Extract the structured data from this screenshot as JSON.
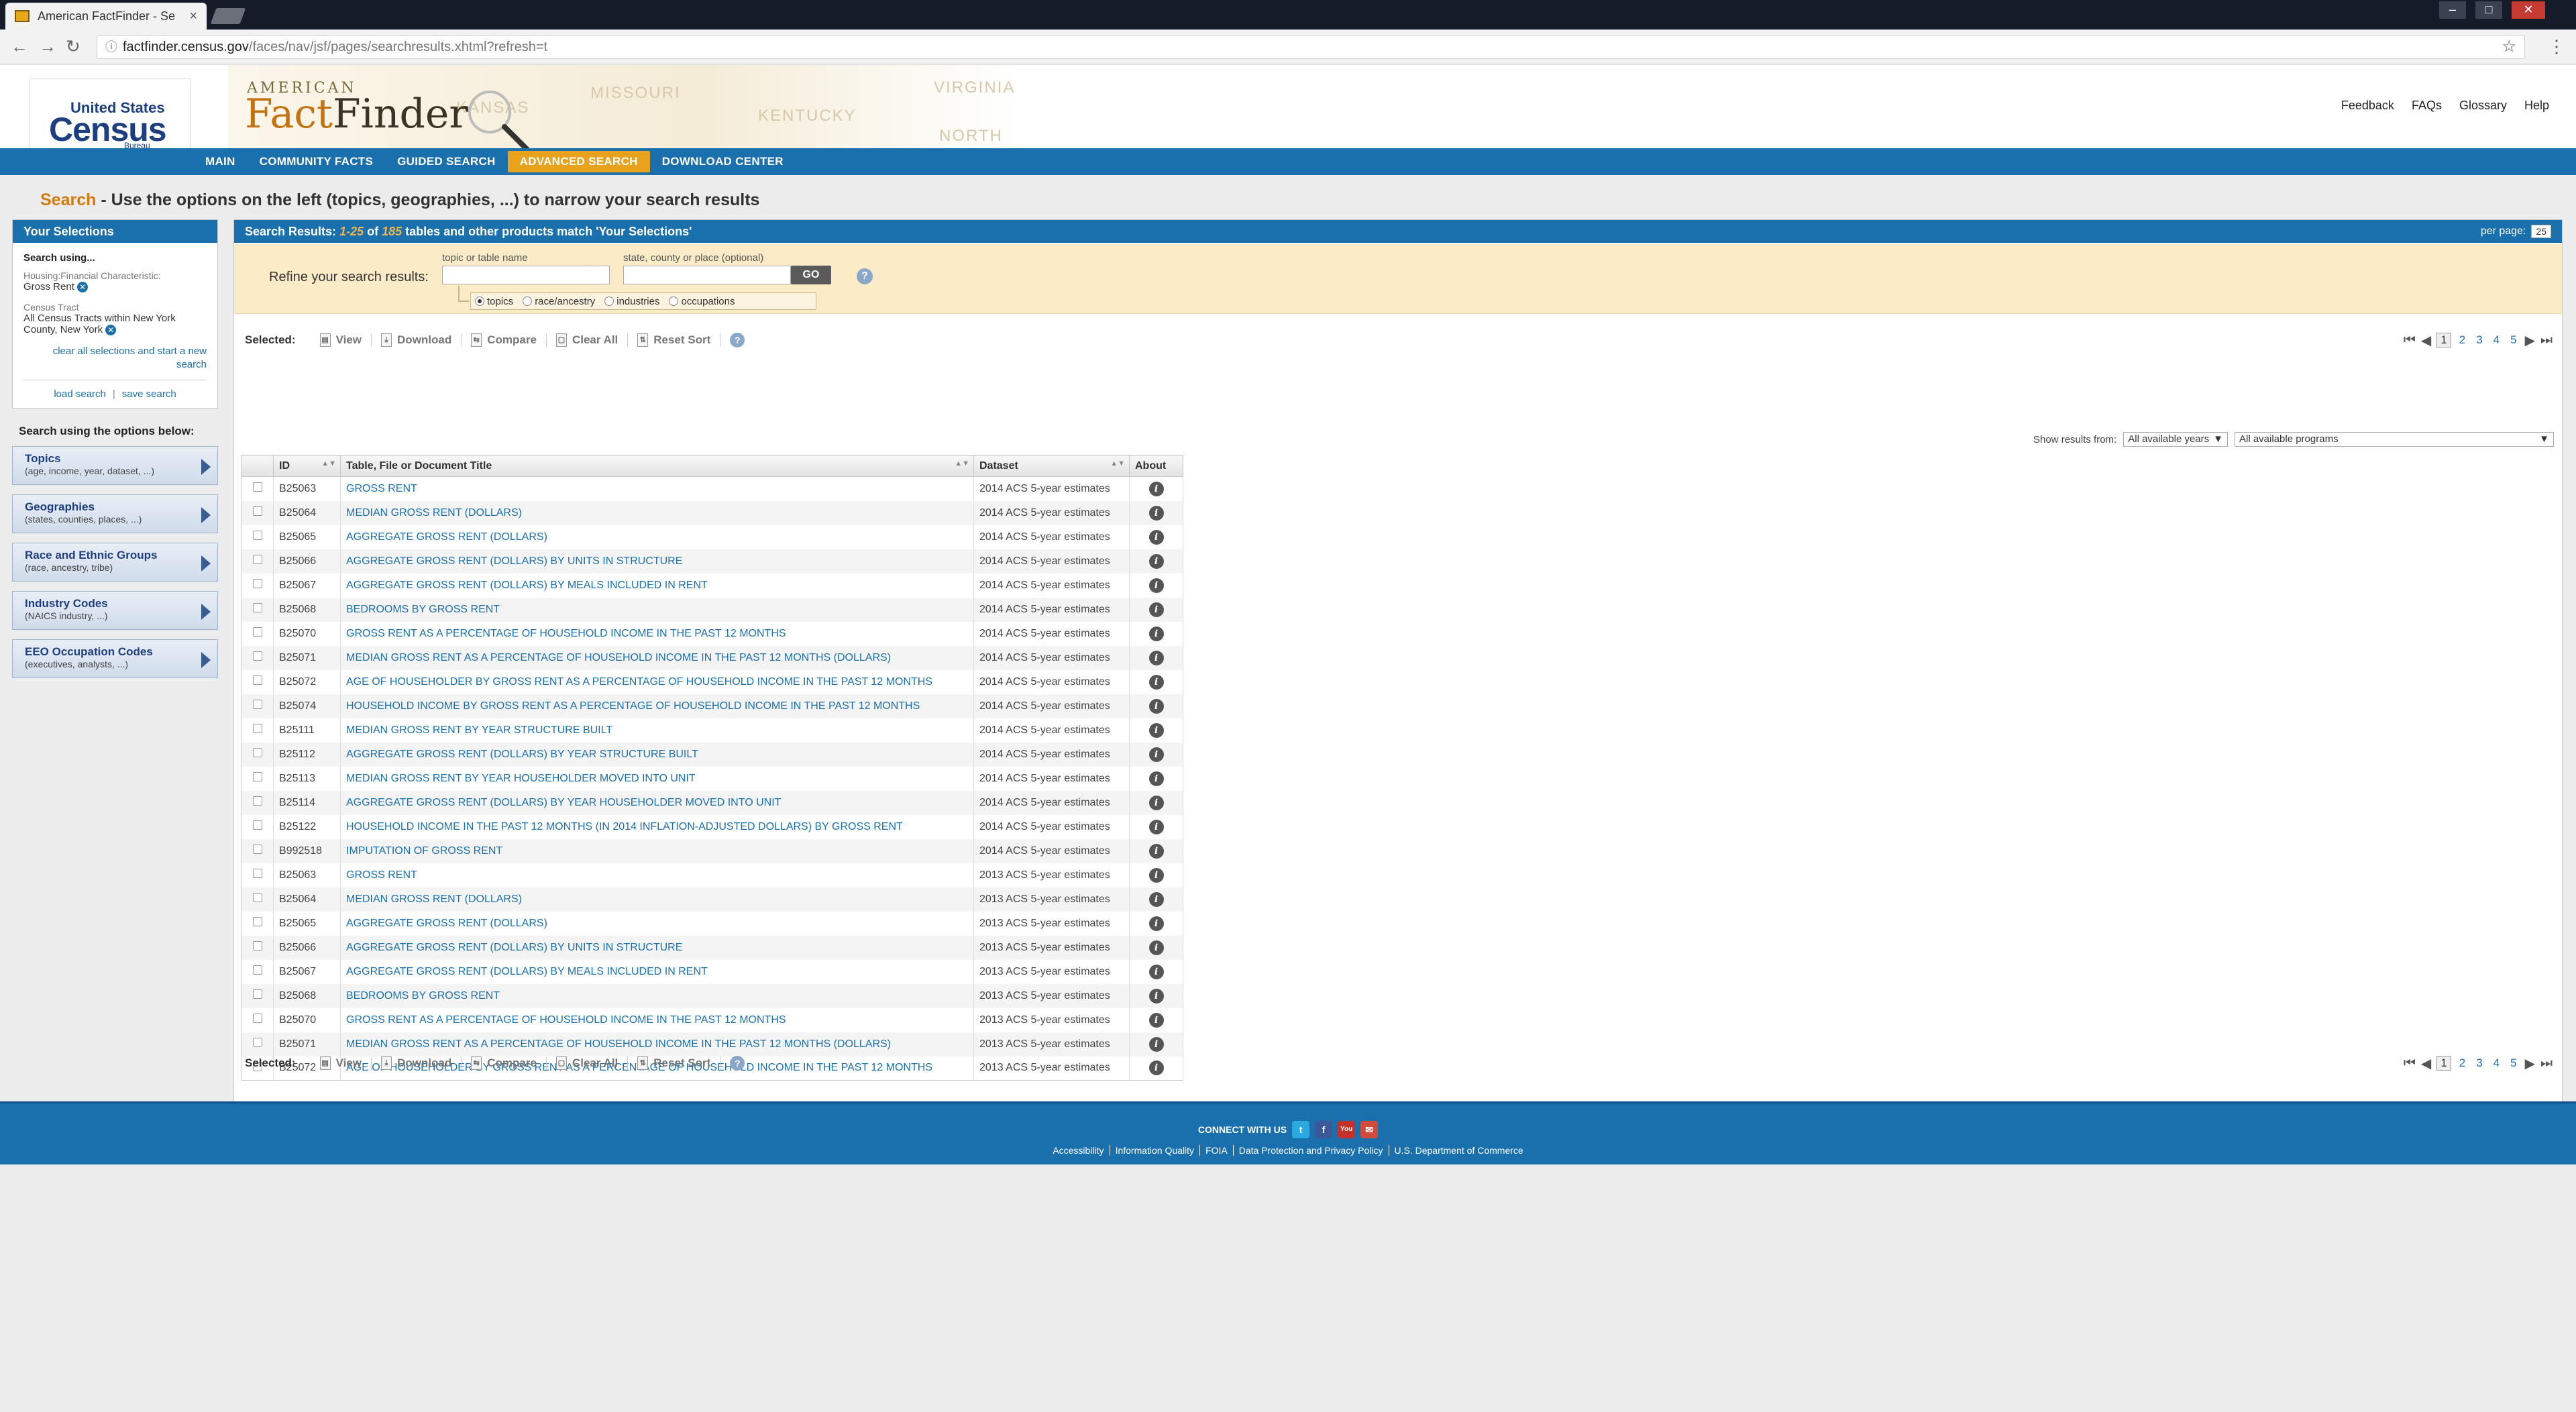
{
  "browser": {
    "tab_title": "American FactFinder - Se",
    "tab_close": "×",
    "url_host": "factfinder.census.gov",
    "url_path": "/faces/nav/jsf/pages/searchresults.xhtml?refresh=t",
    "back_glyph": "←",
    "forward_glyph": "→",
    "reload_glyph": "↻",
    "lock_glyph": "ⓘ",
    "star_glyph": "☆",
    "menu_glyph": "⋮",
    "win_minimize": "–",
    "win_maximize": "□",
    "win_close": "✕"
  },
  "header": {
    "logo_line1": "United States",
    "logo_line2": "Census",
    "logo_line3": "Bureau",
    "brand_small": "AMERICAN",
    "brand_part1": "Fact",
    "brand_part2": "Finder",
    "map_labels": [
      "MISSOURI",
      "KENTUCKY",
      "VIRGINIA",
      "NORTH",
      "KANSAS"
    ],
    "links": [
      "Feedback",
      "FAQs",
      "Glossary",
      "Help"
    ]
  },
  "nav": {
    "items": [
      "MAIN",
      "COMMUNITY FACTS",
      "GUIDED SEARCH",
      "ADVANCED SEARCH",
      "DOWNLOAD CENTER"
    ],
    "active_index": 3
  },
  "page_title": {
    "lead": "Search",
    "text": " - Use the options on the left (topics, geographies, ...) to narrow your search results"
  },
  "selections": {
    "heading": "Your Selections",
    "search_using": "Search using...",
    "items": [
      {
        "category": "Housing:Financial Characteristic:",
        "value": "Gross Rent"
      },
      {
        "category": "Census Tract",
        "value": "All Census Tracts within New York County, New York"
      }
    ],
    "remove_glyph": "✕",
    "clear_link": "clear all selections and start a new search",
    "load_search": "load search",
    "separator": "|",
    "save_search": "save search"
  },
  "search_options": {
    "heading": "Search using the options below:",
    "options": [
      {
        "title": "Topics",
        "subtitle": "(age, income, year, dataset, ...)"
      },
      {
        "title": "Geographies",
        "subtitle": "(states, counties, places, ...)"
      },
      {
        "title": "Race and Ethnic Groups",
        "subtitle": "(race, ancestry, tribe)"
      },
      {
        "title": "Industry Codes",
        "subtitle": "(NAICS industry, ...)"
      },
      {
        "title": "EEO Occupation Codes",
        "subtitle": "(executives, analysts, ...)"
      }
    ]
  },
  "results_header": {
    "prefix": "Search Results: ",
    "range": "1-25",
    "of": " of ",
    "total": "185",
    "suffix": " tables and other products match 'Your Selections'",
    "per_page_label": "per page:",
    "per_page_value": "25"
  },
  "refine": {
    "label": "Refine your search results:",
    "topic_label": "topic or table name",
    "geo_label": "state, county or place (optional)",
    "topic_value": "",
    "geo_value": "",
    "go": "GO",
    "help": "?",
    "radios": [
      {
        "label": "topics",
        "checked": true
      },
      {
        "label": "race/ancestry",
        "checked": false
      },
      {
        "label": "industries",
        "checked": false
      },
      {
        "label": "occupations",
        "checked": false
      }
    ]
  },
  "toolbar": {
    "selected": "Selected:",
    "view": "View",
    "download": "Download",
    "compare": "Compare",
    "clear_all": "Clear All",
    "reset_sort": "Reset Sort",
    "help": "?",
    "icon_view": "▤",
    "icon_download": "⤓",
    "icon_compare": "⇆",
    "icon_clear": "▢",
    "icon_reset": "⇅"
  },
  "pager": {
    "first": "⏮",
    "prev": "◀",
    "pages": [
      "1",
      "2",
      "3",
      "4",
      "5"
    ],
    "current": "1",
    "next": "▶",
    "last": "⏭"
  },
  "filters": {
    "label": "Show results from:",
    "years": "All available years",
    "programs": "All available programs",
    "caret": "▼"
  },
  "table": {
    "columns": [
      "ID",
      "Table, File or Document Title",
      "Dataset",
      "About"
    ],
    "sort_glyph": "▲▼",
    "info_glyph": "i",
    "rows": [
      [
        "B25063",
        "GROSS RENT",
        "2014 ACS 5-year estimates"
      ],
      [
        "B25064",
        "MEDIAN GROSS RENT (DOLLARS)",
        "2014 ACS 5-year estimates"
      ],
      [
        "B25065",
        "AGGREGATE GROSS RENT (DOLLARS)",
        "2014 ACS 5-year estimates"
      ],
      [
        "B25066",
        "AGGREGATE GROSS RENT (DOLLARS) BY UNITS IN STRUCTURE",
        "2014 ACS 5-year estimates"
      ],
      [
        "B25067",
        "AGGREGATE GROSS RENT (DOLLARS) BY MEALS INCLUDED IN RENT",
        "2014 ACS 5-year estimates"
      ],
      [
        "B25068",
        "BEDROOMS BY GROSS RENT",
        "2014 ACS 5-year estimates"
      ],
      [
        "B25070",
        "GROSS RENT AS A PERCENTAGE OF HOUSEHOLD INCOME IN THE PAST 12 MONTHS",
        "2014 ACS 5-year estimates"
      ],
      [
        "B25071",
        "MEDIAN GROSS RENT AS A PERCENTAGE OF HOUSEHOLD INCOME IN THE PAST 12 MONTHS (DOLLARS)",
        "2014 ACS 5-year estimates"
      ],
      [
        "B25072",
        "AGE OF HOUSEHOLDER BY GROSS RENT AS A PERCENTAGE OF HOUSEHOLD INCOME IN THE PAST 12 MONTHS",
        "2014 ACS 5-year estimates"
      ],
      [
        "B25074",
        "HOUSEHOLD INCOME BY GROSS RENT AS A PERCENTAGE OF HOUSEHOLD INCOME IN THE PAST 12 MONTHS",
        "2014 ACS 5-year estimates"
      ],
      [
        "B25111",
        "MEDIAN GROSS RENT BY YEAR STRUCTURE BUILT",
        "2014 ACS 5-year estimates"
      ],
      [
        "B25112",
        "AGGREGATE GROSS RENT (DOLLARS) BY YEAR STRUCTURE BUILT",
        "2014 ACS 5-year estimates"
      ],
      [
        "B25113",
        "MEDIAN GROSS RENT BY YEAR HOUSEHOLDER MOVED INTO UNIT",
        "2014 ACS 5-year estimates"
      ],
      [
        "B25114",
        "AGGREGATE GROSS RENT (DOLLARS) BY YEAR HOUSEHOLDER MOVED INTO UNIT",
        "2014 ACS 5-year estimates"
      ],
      [
        "B25122",
        "HOUSEHOLD INCOME IN THE PAST 12 MONTHS (IN 2014 INFLATION-ADJUSTED DOLLARS) BY GROSS RENT",
        "2014 ACS 5-year estimates"
      ],
      [
        "B992518",
        "IMPUTATION OF GROSS RENT",
        "2014 ACS 5-year estimates"
      ],
      [
        "B25063",
        "GROSS RENT",
        "2013 ACS 5-year estimates"
      ],
      [
        "B25064",
        "MEDIAN GROSS RENT (DOLLARS)",
        "2013 ACS 5-year estimates"
      ],
      [
        "B25065",
        "AGGREGATE GROSS RENT (DOLLARS)",
        "2013 ACS 5-year estimates"
      ],
      [
        "B25066",
        "AGGREGATE GROSS RENT (DOLLARS) BY UNITS IN STRUCTURE",
        "2013 ACS 5-year estimates"
      ],
      [
        "B25067",
        "AGGREGATE GROSS RENT (DOLLARS) BY MEALS INCLUDED IN RENT",
        "2013 ACS 5-year estimates"
      ],
      [
        "B25068",
        "BEDROOMS BY GROSS RENT",
        "2013 ACS 5-year estimates"
      ],
      [
        "B25070",
        "GROSS RENT AS A PERCENTAGE OF HOUSEHOLD INCOME IN THE PAST 12 MONTHS",
        "2013 ACS 5-year estimates"
      ],
      [
        "B25071",
        "MEDIAN GROSS RENT AS A PERCENTAGE OF HOUSEHOLD INCOME IN THE PAST 12 MONTHS (DOLLARS)",
        "2013 ACS 5-year estimates"
      ],
      [
        "B25072",
        "AGE OF HOUSEHOLDER BY GROSS RENT AS A PERCENTAGE OF HOUSEHOLD INCOME IN THE PAST 12 MONTHS",
        "2013 ACS 5-year estimates"
      ]
    ]
  },
  "footer": {
    "connect": "CONNECT WITH US",
    "social": [
      "t",
      "f",
      "You",
      "✉"
    ],
    "links": [
      "Accessibility",
      "Information Quality",
      "FOIA",
      "Data Protection and Privacy Policy",
      "U.S. Department of Commerce"
    ]
  },
  "colors": {
    "primary_blue": "#1a6fad",
    "accent_orange": "#e8a21c",
    "refine_bg": "#fbebc7"
  }
}
